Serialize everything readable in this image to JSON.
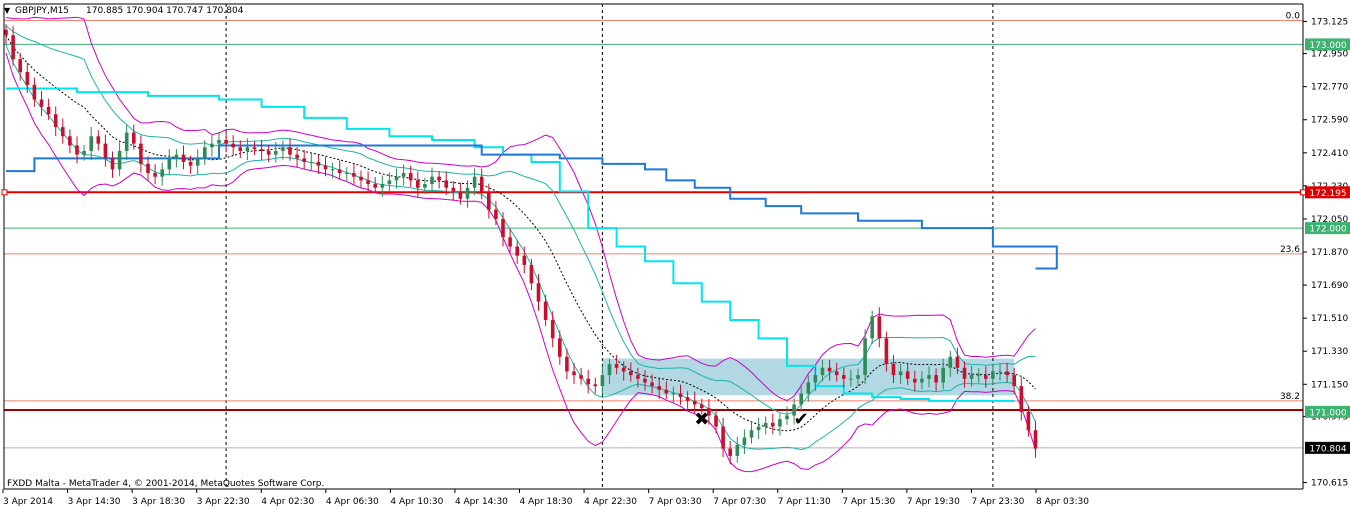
{
  "header": {
    "symbol": "GBPJPY,M15",
    "ohlc": "170.885 170.904 170.747 170.804"
  },
  "copyright": "FXDD Malta - MetaTrader 4, © 2001-2014, MetaQuotes Software Corp.",
  "colors": {
    "up_candle": "#2e8b57",
    "down_candle": "#c8102e",
    "upper_band": "#cc00cc",
    "inner_band": "#20b2aa",
    "mid_dash": "#000000",
    "cyan_line": "#00e5ee",
    "blue_line": "#1e78d8",
    "red_level": "#e00000",
    "fib_level": "#f08070",
    "green_level": "#3cb371",
    "zone": "#a8d4e0",
    "dark_red_level": "#a00000",
    "gray_line": "#b0b0b0",
    "last_price_bg": "#000000"
  },
  "chart_data": {
    "type": "candlestick",
    "symbol": "GBPJPY",
    "timeframe": "M15",
    "ylim": [
      170.58,
      173.22
    ],
    "y_ticks": [
      "173.125",
      "172.950",
      "172.770",
      "172.590",
      "172.410",
      "172.230",
      "172.050",
      "171.870",
      "171.690",
      "171.510",
      "171.330",
      "171.150",
      "170.975",
      "170.615"
    ],
    "x_ticks": [
      "3 Apr 2014",
      "3 Apr 14:30",
      "3 Apr 18:30",
      "3 Apr 22:30",
      "4 Apr 02:30",
      "4 Apr 06:30",
      "4 Apr 10:30",
      "4 Apr 14:30",
      "4 Apr 18:30",
      "4 Apr 22:30",
      "7 Apr 03:30",
      "7 Apr 07:30",
      "7 Apr 11:30",
      "7 Apr 15:30",
      "7 Apr 19:30",
      "7 Apr 23:30",
      "8 Apr 03:30"
    ],
    "price_tags": [
      {
        "label": "173.000",
        "value": 173.0,
        "color": "#3cb371"
      },
      {
        "label": "172.195",
        "value": 172.195,
        "color": "#e00000"
      },
      {
        "label": "172.000",
        "value": 172.0,
        "color": "#3cb371"
      },
      {
        "label": "171.000",
        "value": 171.0,
        "color": "#3cb371"
      },
      {
        "label": "170.804",
        "value": 170.804,
        "color": "#000000"
      }
    ],
    "levels": [
      {
        "name": "fib-0",
        "value": 173.13,
        "label": "0.0",
        "color": "#f08070"
      },
      {
        "name": "green-173",
        "value": 173.0,
        "label": "",
        "color": "#3cb371"
      },
      {
        "name": "red-172195",
        "value": 172.195,
        "label": "",
        "color": "#e00000"
      },
      {
        "name": "green-172",
        "value": 172.0,
        "label": "",
        "color": "#3cb371"
      },
      {
        "name": "fib-23.6",
        "value": 171.86,
        "label": "23.6",
        "color": "#f08070"
      },
      {
        "name": "fib-38.2",
        "value": 171.06,
        "label": "38.2",
        "color": "#f08070"
      },
      {
        "name": "darkred-171",
        "value": 171.01,
        "label": "",
        "color": "#a00000"
      },
      {
        "name": "gray-last",
        "value": 170.804,
        "label": "",
        "color": "#b0b0b0"
      }
    ],
    "zone": {
      "from_bar": 84,
      "to_bar": 142,
      "high": 171.29,
      "low": 171.09
    },
    "vertical_separators": [
      31,
      84,
      139
    ],
    "markers": [
      {
        "type": "cross",
        "bar": 98,
        "value": 170.96,
        "glyph": "✖",
        "color": "#e8308c"
      },
      {
        "type": "check",
        "bar": 112,
        "value": 170.96,
        "glyph": "✔",
        "color": "#e8308c"
      }
    ],
    "closes": [
      173.05,
      172.92,
      172.85,
      172.78,
      172.7,
      172.66,
      172.62,
      172.55,
      172.5,
      172.45,
      172.4,
      172.42,
      172.5,
      172.46,
      172.38,
      172.32,
      172.42,
      172.52,
      172.46,
      172.35,
      172.3,
      172.28,
      172.32,
      172.38,
      172.4,
      172.36,
      172.34,
      172.38,
      172.44,
      172.46,
      172.48,
      172.46,
      172.44,
      172.42,
      172.44,
      172.43,
      172.42,
      172.4,
      172.42,
      172.44,
      172.4,
      172.38,
      172.36,
      172.36,
      172.34,
      172.32,
      172.32,
      172.3,
      172.3,
      172.28,
      172.26,
      172.24,
      172.22,
      172.24,
      172.26,
      172.28,
      172.3,
      172.26,
      172.22,
      172.24,
      172.28,
      172.26,
      172.22,
      172.2,
      172.16,
      172.22,
      172.28,
      172.2,
      172.1,
      172.05,
      171.95,
      171.9,
      171.85,
      171.8,
      171.7,
      171.6,
      171.5,
      171.4,
      171.3,
      171.22,
      171.2,
      171.18,
      171.15,
      171.14,
      171.2,
      171.26,
      171.24,
      171.22,
      171.2,
      171.18,
      171.16,
      171.14,
      171.12,
      171.1,
      171.1,
      171.08,
      171.06,
      171.04,
      171.02,
      170.98,
      170.92,
      170.8,
      170.76,
      170.82,
      170.86,
      170.9,
      170.92,
      170.94,
      170.92,
      170.96,
      170.98,
      171.04,
      171.1,
      171.16,
      171.2,
      171.24,
      171.22,
      171.2,
      171.18,
      171.18,
      171.2,
      171.4,
      171.52,
      171.4,
      171.26,
      171.2,
      171.22,
      171.18,
      171.16,
      171.18,
      171.2,
      171.16,
      171.24,
      171.3,
      171.24,
      171.18,
      171.2,
      171.2,
      171.18,
      171.22,
      171.22,
      171.2,
      171.14,
      171.0,
      170.9,
      170.8
    ],
    "blue_steps": [
      [
        0,
        172.31
      ],
      [
        4,
        172.38
      ],
      [
        30,
        172.45
      ],
      [
        67,
        172.4
      ],
      [
        78,
        172.38
      ],
      [
        84,
        172.35
      ],
      [
        90,
        172.32
      ],
      [
        93,
        172.26
      ],
      [
        97,
        172.22
      ],
      [
        102,
        172.16
      ],
      [
        107,
        172.12
      ],
      [
        112,
        172.08
      ],
      [
        120,
        172.04
      ],
      [
        129,
        172.0
      ],
      [
        139,
        171.9
      ],
      [
        148,
        171.78
      ]
    ],
    "cyan_steps": [
      [
        0,
        172.76
      ],
      [
        10,
        172.74
      ],
      [
        20,
        172.72
      ],
      [
        30,
        172.7
      ],
      [
        36,
        172.66
      ],
      [
        42,
        172.6
      ],
      [
        48,
        172.54
      ],
      [
        54,
        172.5
      ],
      [
        60,
        172.48
      ],
      [
        66,
        172.44
      ],
      [
        70,
        172.4
      ],
      [
        74,
        172.36
      ],
      [
        78,
        172.2
      ],
      [
        82,
        172.0
      ],
      [
        86,
        171.9
      ],
      [
        90,
        171.82
      ],
      [
        94,
        171.7
      ],
      [
        98,
        171.6
      ],
      [
        102,
        171.5
      ],
      [
        106,
        171.4
      ],
      [
        110,
        171.25
      ],
      [
        114,
        171.14
      ],
      [
        118,
        171.1
      ],
      [
        122,
        171.08
      ],
      [
        126,
        171.07
      ],
      [
        130,
        171.06
      ],
      [
        140,
        171.06
      ]
    ]
  }
}
